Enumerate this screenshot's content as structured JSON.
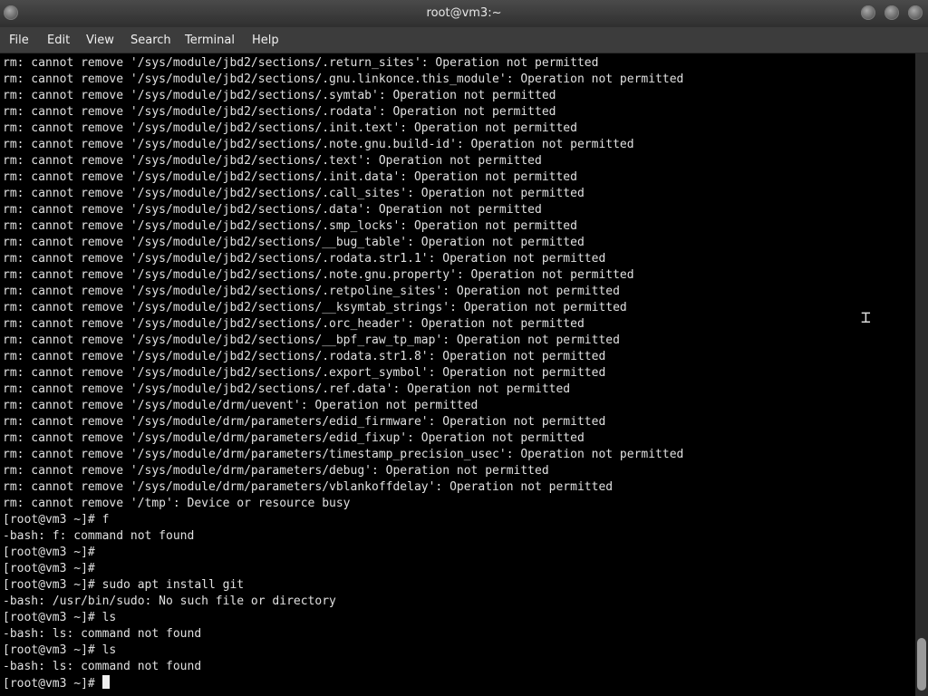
{
  "window": {
    "title": "root@vm3:~"
  },
  "menu": [
    "File",
    "Edit",
    "View",
    "Search",
    "Terminal",
    "Help"
  ],
  "terminal": {
    "lines": [
      "rm: cannot remove '/sys/module/jbd2/sections/.return_sites': Operation not permitted",
      "rm: cannot remove '/sys/module/jbd2/sections/.gnu.linkonce.this_module': Operation not permitted",
      "rm: cannot remove '/sys/module/jbd2/sections/.symtab': Operation not permitted",
      "rm: cannot remove '/sys/module/jbd2/sections/.rodata': Operation not permitted",
      "rm: cannot remove '/sys/module/jbd2/sections/.init.text': Operation not permitted",
      "rm: cannot remove '/sys/module/jbd2/sections/.note.gnu.build-id': Operation not permitted",
      "rm: cannot remove '/sys/module/jbd2/sections/.text': Operation not permitted",
      "rm: cannot remove '/sys/module/jbd2/sections/.init.data': Operation not permitted",
      "rm: cannot remove '/sys/module/jbd2/sections/.call_sites': Operation not permitted",
      "rm: cannot remove '/sys/module/jbd2/sections/.data': Operation not permitted",
      "rm: cannot remove '/sys/module/jbd2/sections/.smp_locks': Operation not permitted",
      "rm: cannot remove '/sys/module/jbd2/sections/__bug_table': Operation not permitted",
      "rm: cannot remove '/sys/module/jbd2/sections/.rodata.str1.1': Operation not permitted",
      "rm: cannot remove '/sys/module/jbd2/sections/.note.gnu.property': Operation not permitted",
      "rm: cannot remove '/sys/module/jbd2/sections/.retpoline_sites': Operation not permitted",
      "rm: cannot remove '/sys/module/jbd2/sections/__ksymtab_strings': Operation not permitted",
      "rm: cannot remove '/sys/module/jbd2/sections/.orc_header': Operation not permitted",
      "rm: cannot remove '/sys/module/jbd2/sections/__bpf_raw_tp_map': Operation not permitted",
      "rm: cannot remove '/sys/module/jbd2/sections/.rodata.str1.8': Operation not permitted",
      "rm: cannot remove '/sys/module/jbd2/sections/.export_symbol': Operation not permitted",
      "rm: cannot remove '/sys/module/jbd2/sections/.ref.data': Operation not permitted",
      "rm: cannot remove '/sys/module/drm/uevent': Operation not permitted",
      "rm: cannot remove '/sys/module/drm/parameters/edid_firmware': Operation not permitted",
      "rm: cannot remove '/sys/module/drm/parameters/edid_fixup': Operation not permitted",
      "rm: cannot remove '/sys/module/drm/parameters/timestamp_precision_usec': Operation not permitted",
      "rm: cannot remove '/sys/module/drm/parameters/debug': Operation not permitted",
      "rm: cannot remove '/sys/module/drm/parameters/vblankoffdelay': Operation not permitted",
      "rm: cannot remove '/tmp': Device or resource busy",
      "[root@vm3 ~]# f",
      "-bash: f: command not found",
      "[root@vm3 ~]#",
      "[root@vm3 ~]#",
      "[root@vm3 ~]# sudo apt install git",
      "-bash: /usr/bin/sudo: No such file or directory",
      "[root@vm3 ~]# ls",
      "-bash: ls: command not found",
      "[root@vm3 ~]# ls",
      "-bash: ls: command not found"
    ],
    "prompt": "[root@vm3 ~]# "
  },
  "colors": {
    "terminal_bg": "#000000",
    "terminal_fg": "#e0e0e0",
    "titlebar": "#3a3a3a"
  }
}
